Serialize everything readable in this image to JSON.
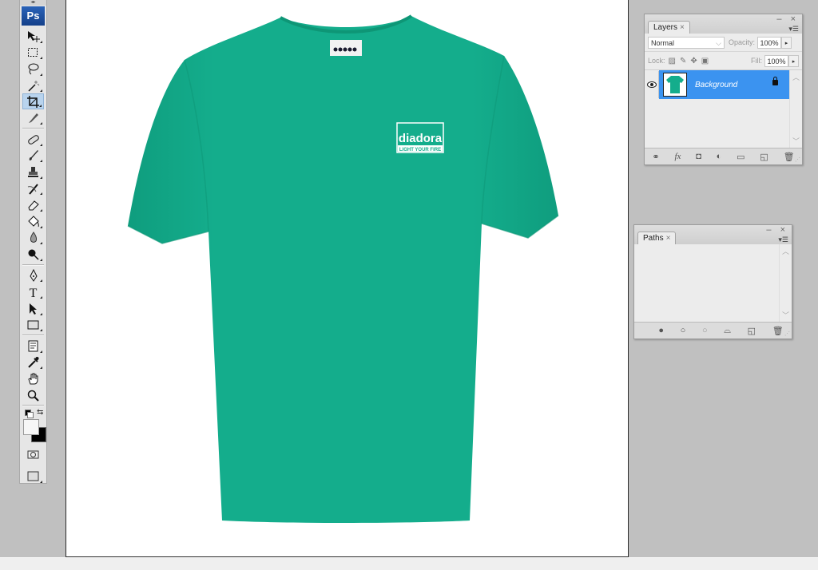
{
  "app": {
    "logo": "Ps"
  },
  "toolbox": {
    "grip": "◂▸",
    "tools": [
      {
        "name": "move-tool",
        "glyph": "move"
      },
      {
        "name": "marquee-tool",
        "glyph": "marquee"
      },
      {
        "name": "lasso-tool",
        "glyph": "lasso"
      },
      {
        "name": "magic-wand-tool",
        "glyph": "wand"
      },
      {
        "name": "crop-tool",
        "glyph": "crop",
        "active": true
      },
      {
        "name": "slice-tool",
        "glyph": "slice"
      },
      {
        "name": "healing-brush-tool",
        "glyph": "heal"
      },
      {
        "name": "brush-tool",
        "glyph": "brush"
      },
      {
        "name": "clone-stamp-tool",
        "glyph": "stamp"
      },
      {
        "name": "history-brush-tool",
        "glyph": "history"
      },
      {
        "name": "eraser-tool",
        "glyph": "eraser"
      },
      {
        "name": "paint-bucket-tool",
        "glyph": "bucket"
      },
      {
        "name": "blur-tool",
        "glyph": "blur"
      },
      {
        "name": "dodge-tool",
        "glyph": "dodge"
      },
      {
        "name": "pen-tool",
        "glyph": "pen"
      },
      {
        "name": "type-tool",
        "glyph": "type"
      },
      {
        "name": "path-selection-tool",
        "glyph": "pathsel"
      },
      {
        "name": "shape-tool",
        "glyph": "shape"
      },
      {
        "name": "notes-tool",
        "glyph": "notes"
      },
      {
        "name": "eyedropper-tool",
        "glyph": "eyedrop"
      },
      {
        "name": "hand-tool",
        "glyph": "hand"
      },
      {
        "name": "zoom-tool",
        "glyph": "zoom"
      }
    ],
    "foreground_color": "#f7f7f7",
    "background_color": "#000000",
    "swap_glyph": "⇆"
  },
  "canvas": {
    "shirt_color": "#14b08e",
    "logo_text": "diadora",
    "logo_tagline": "LIGHT YOUR FIRE",
    "neck_label": "diadora"
  },
  "layers_panel": {
    "tab_label": "Layers",
    "close_glyph": "×",
    "window_controls": "– ×",
    "menu_glyph": "▾☰",
    "blend_mode": "Normal",
    "opacity_label": "Opacity:",
    "opacity_value": "100%",
    "lock_label": "Lock:",
    "fill_label": "Fill:",
    "fill_value": "100%",
    "layers": [
      {
        "name": "Background",
        "visible": true,
        "locked": true,
        "selected": true
      }
    ],
    "selection_color": "#3b93f0",
    "footer_icons": [
      "link-layers-icon",
      "fx-icon",
      "layer-mask-icon",
      "adjustment-layer-icon",
      "group-folder-icon",
      "new-layer-icon",
      "trash-icon"
    ]
  },
  "paths_panel": {
    "tab_label": "Paths",
    "close_glyph": "×",
    "window_controls": "– ×",
    "menu_glyph": "▾☰",
    "footer_icons": [
      "fill-path-icon",
      "stroke-path-icon",
      "load-selection-icon",
      "make-work-path-icon",
      "new-path-icon",
      "trash-icon"
    ]
  }
}
